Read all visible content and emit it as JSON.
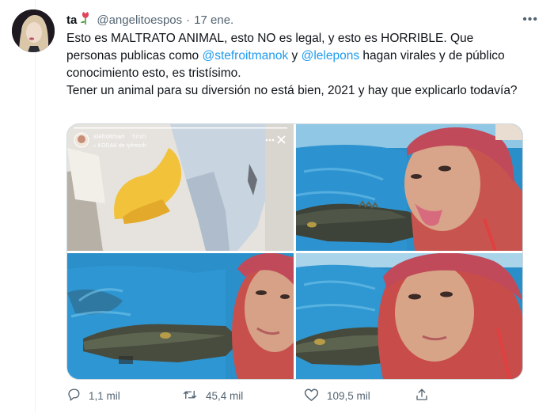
{
  "tweet": {
    "display_name": "ta",
    "handle": "@angelitoespos",
    "separator": "·",
    "date": "17 ene.",
    "more_label": "•••",
    "text": {
      "part1": "Esto es MALTRATO ANIMAL, esto NO es legal, y esto es HORRIBLE. Que personas publicas como ",
      "mention1": "@stefroitmanok",
      "part2": " y ",
      "mention2": "@lelepons",
      "part3": " hagan virales y de público conocimiento esto, es tristísimo.",
      "line2": "Tener un animal para su diversión no está bien, 2021 y hay que explicarlo todavía?"
    }
  },
  "story_overlay": {
    "username": "stefroitman",
    "time": "6min",
    "music": "♪ KODAK de tyfrench"
  },
  "actions": {
    "replies": "1,1 mil",
    "retweets": "45,4 mil",
    "likes": "109,5 mil"
  },
  "colors": {
    "accent": "#1d9bf0",
    "secondary_text": "#536471",
    "border": "#cfd9de"
  },
  "icons": [
    "reply-icon",
    "retweet-icon",
    "like-icon",
    "share-icon",
    "more-icon",
    "close-icon",
    "flower-icon"
  ]
}
